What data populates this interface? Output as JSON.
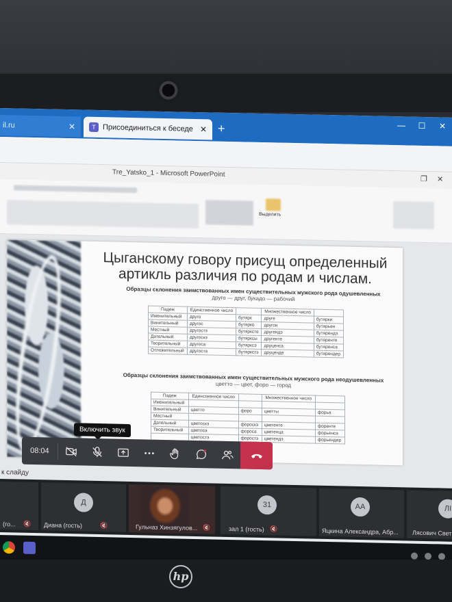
{
  "browser": {
    "tabs": [
      {
        "label": "il.ru",
        "active": false
      },
      {
        "label": "Присоединиться к беседе",
        "active": true
      }
    ],
    "new_tab_label": "+",
    "close_label": "✕"
  },
  "powerpoint": {
    "window_title": "Tre_Yatsko_1 - Microsoft PowerPoint",
    "ribbon_label": "Выделить"
  },
  "slide": {
    "heading": "Цыганскому говору присущ определенный артикль различия по родам и числам.",
    "table1": {
      "caption_bold": "Образцы склонения заимствованных имен существительных мужского рода одушевленных",
      "caption_normal": "друго — друг, букадо — рабочий",
      "headers": [
        "Падеж",
        "Единственное число",
        "",
        "Множественное число",
        ""
      ],
      "rows": [
        [
          "Именительный",
          "друго",
          "бутярк",
          "друге",
          "бутярки"
        ],
        [
          "Винительный",
          "другос",
          "бутярко",
          "другон",
          "бутярьен"
        ],
        [
          "Местный",
          "другостэ",
          "бутярксте",
          "другендэ",
          "бутярендэ"
        ],
        [
          "Дательный",
          "другоскэ",
          "бутярксы",
          "другенте",
          "бутяренте"
        ],
        [
          "Творительный",
          "другоса",
          "бутярксэ",
          "друценса",
          "бутяренса"
        ],
        [
          "Отложительный",
          "другоста",
          "бутяркстэ",
          "друценде",
          "бутярендер"
        ]
      ]
    },
    "table2": {
      "caption_bold": "Образцы склонения заимствованных имен существительных мужского рода неодушевленных",
      "caption_normal": "цветто — цвет, форо — город",
      "headers": [
        "Падеж",
        "Единственное число",
        "",
        "Множественное число",
        ""
      ],
      "rows": [
        [
          "Именительный",
          "",
          "",
          "",
          ""
        ],
        [
          "Винительный",
          "цветто",
          "форо",
          "цветты",
          "форья"
        ],
        [
          "Местный",
          "",
          "",
          "",
          ""
        ],
        [
          "Дательный",
          "цветоскэ",
          "фороскэ",
          "цветенте",
          "форенте"
        ],
        [
          "Творительный",
          "цветоса",
          "фороса",
          "цветенца",
          "форьенса"
        ],
        [
          "",
          "цветостэ",
          "форостэ",
          "цветендэ",
          "форьендер"
        ]
      ]
    }
  },
  "call_controls": {
    "timer": "08:04",
    "tooltip": "Включить звук",
    "buttons": [
      "camera-off",
      "mic-off",
      "share-screen",
      "more",
      "raise-hand",
      "chat",
      "participants",
      "hang-up"
    ]
  },
  "slide_nav_label": "к слайду",
  "participants": [
    {
      "name": "(го...",
      "initials": "",
      "muted": true
    },
    {
      "name": "Диана (гость)",
      "initials": "Д",
      "muted": true
    },
    {
      "name": "Гульназ Хинзягулов...",
      "initials": "",
      "muted": true,
      "video": true
    },
    {
      "name": "зал 1 (гость)",
      "initials": "31",
      "muted": true
    },
    {
      "name": "Яцкина Александра, Абр...",
      "initials": "АА",
      "muted": false
    },
    {
      "name": "Лясович Свет",
      "initials": "ЛІ",
      "muted": true
    }
  ],
  "colors": {
    "browser_accent": "#1e6bc2",
    "hangup": "#c4314b",
    "call_bar": "#3a3b40"
  }
}
